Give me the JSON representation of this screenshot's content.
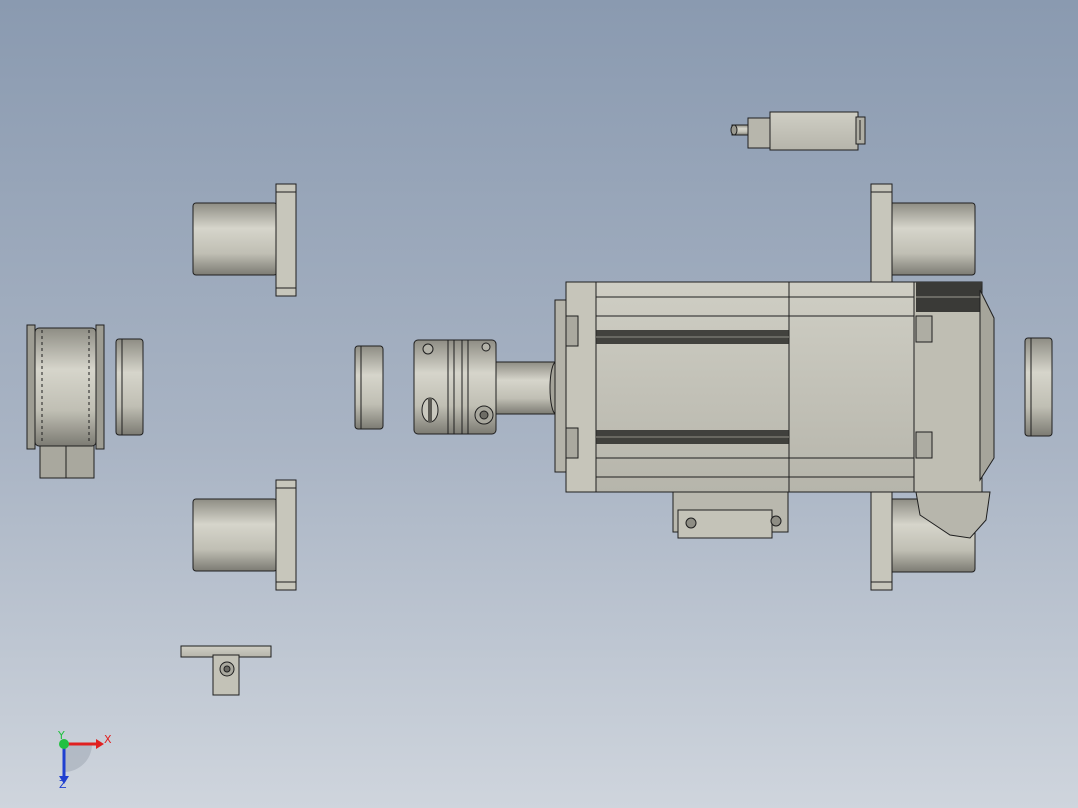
{
  "view": {
    "background_top": "#8a9ab0",
    "background_bottom": "#cfd5dd",
    "part_color": "#c4c3b8",
    "part_shadow": "#8d8c83",
    "edge_color": "#1f1f1f"
  },
  "triad": {
    "x_label": "X",
    "y_label": "Y",
    "z_label": "Z",
    "x_color": "#e02020",
    "y_color": "#20c040",
    "z_color": "#2040d0"
  }
}
